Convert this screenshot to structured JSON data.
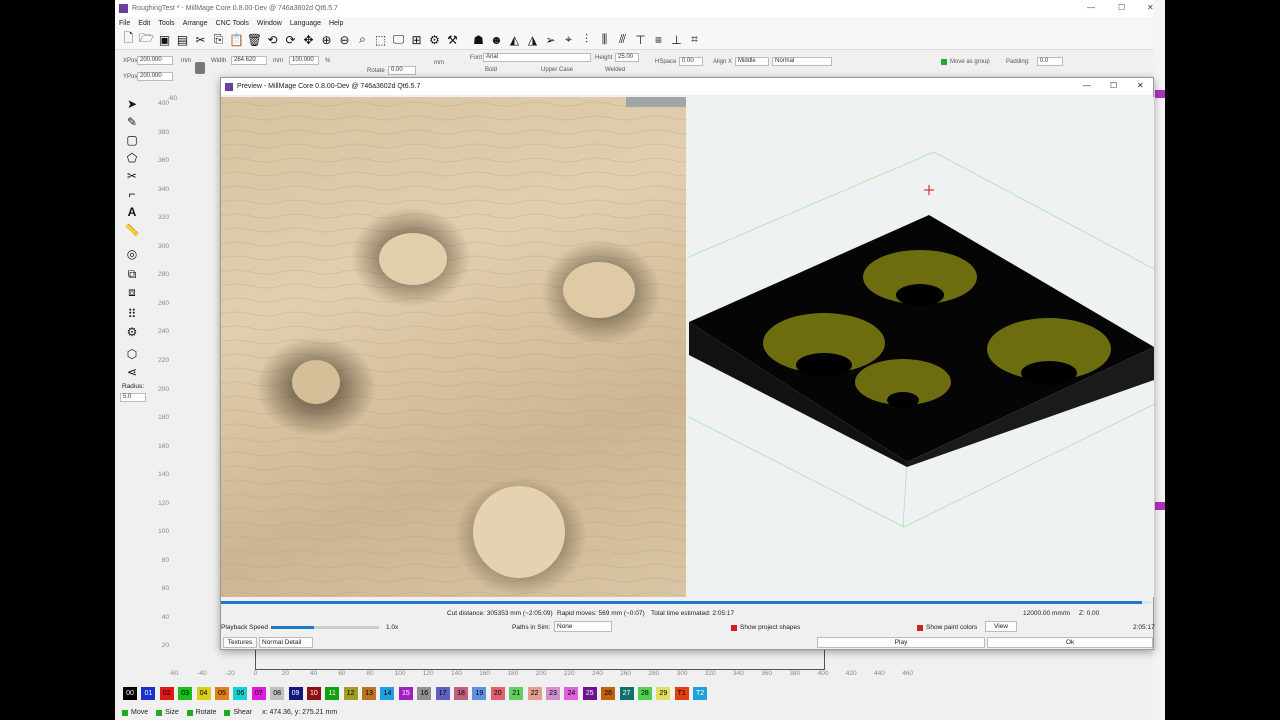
{
  "app": {
    "title": "RoughingTest * - MillMage Core 0.8.00-Dev @ 746a3602d Qt6.5.7",
    "menu": [
      "File",
      "Edit",
      "Tools",
      "Arrange",
      "CNC Tools",
      "Window",
      "Language",
      "Help"
    ]
  },
  "properties": {
    "xpos_label": "XPos",
    "xpos": "200.000",
    "ypos_label": "YPos",
    "ypos": "200.000",
    "width_label": "Width",
    "width": "264.620",
    "unit_mm": "mm",
    "width_pct": "100.000",
    "pct": "%",
    "rotate_label": "Rotate",
    "rotate": "0.00",
    "unit_option": "mm",
    "font_label": "Font",
    "font": "Arial",
    "height_label": "Height",
    "height": "25.00",
    "hspace_label": "HSpace",
    "hspace": "0.00",
    "align_x_label": "Align X",
    "align_x": "Middle",
    "normal": "Normal",
    "bold": "Bold",
    "upper_case": "Upper Case",
    "welded": "Welded",
    "move_as_group": "Move as group",
    "padding_label": "Padding:",
    "padding": "0.0"
  },
  "left_tools": {
    "radius_label": "Radius:",
    "radius": "5.0"
  },
  "ruler_v": [
    "-60",
    "400",
    "380",
    "360",
    "340",
    "320",
    "300",
    "280",
    "260",
    "240",
    "220",
    "200",
    "180",
    "160",
    "140",
    "120",
    "100",
    "80",
    "60",
    "40",
    "20"
  ],
  "ruler_h": [
    "-60",
    "-40",
    "-20",
    "0",
    "20",
    "40",
    "60",
    "80",
    "100",
    "120",
    "140",
    "160",
    "180",
    "200",
    "220",
    "240",
    "260",
    "280",
    "300",
    "320",
    "340",
    "360",
    "380",
    "400",
    "420",
    "440",
    "460"
  ],
  "palette": [
    {
      "label": "00",
      "color": "#000000",
      "text": "#ffffff"
    },
    {
      "label": "01",
      "color": "#1a2fd0",
      "text": "#ffffff"
    },
    {
      "label": "02",
      "color": "#e01818",
      "text": "#000000"
    },
    {
      "label": "03",
      "color": "#18c018",
      "text": "#000000"
    },
    {
      "label": "04",
      "color": "#d8d018",
      "text": "#000000"
    },
    {
      "label": "05",
      "color": "#e08018",
      "text": "#000000"
    },
    {
      "label": "06",
      "color": "#18d0d0",
      "text": "#000000"
    },
    {
      "label": "07",
      "color": "#e018e0",
      "text": "#000000"
    },
    {
      "label": "08",
      "color": "#c0c0c0",
      "text": "#000000"
    },
    {
      "label": "09",
      "color": "#101880",
      "text": "#ffffff"
    },
    {
      "label": "10",
      "color": "#901010",
      "text": "#ffffff"
    },
    {
      "label": "11",
      "color": "#10a010",
      "text": "#ffffff"
    },
    {
      "label": "12",
      "color": "#a0a020",
      "text": "#000000"
    },
    {
      "label": "13",
      "color": "#c07020",
      "text": "#000000"
    },
    {
      "label": "14",
      "color": "#20a0e0",
      "text": "#000000"
    },
    {
      "label": "15",
      "color": "#a020c0",
      "text": "#ffffff"
    },
    {
      "label": "16",
      "color": "#909090",
      "text": "#000000"
    },
    {
      "label": "17",
      "color": "#6060c0",
      "text": "#000000"
    },
    {
      "label": "18",
      "color": "#c06080",
      "text": "#000000"
    },
    {
      "label": "19",
      "color": "#6090e0",
      "text": "#000000"
    },
    {
      "label": "20",
      "color": "#e06070",
      "text": "#000000"
    },
    {
      "label": "21",
      "color": "#60d060",
      "text": "#000000"
    },
    {
      "label": "22",
      "color": "#e0a090",
      "text": "#000000"
    },
    {
      "label": "23",
      "color": "#d090d0",
      "text": "#000000"
    },
    {
      "label": "24",
      "color": "#e060e0",
      "text": "#000000"
    },
    {
      "label": "25",
      "color": "#701090",
      "text": "#ffffff"
    },
    {
      "label": "26",
      "color": "#c06010",
      "text": "#000000"
    },
    {
      "label": "27",
      "color": "#107070",
      "text": "#ffffff"
    },
    {
      "label": "28",
      "color": "#50d050",
      "text": "#000000"
    },
    {
      "label": "29",
      "color": "#e0e060",
      "text": "#000000"
    },
    {
      "label": "T1",
      "color": "#e04010",
      "text": "#000000"
    },
    {
      "label": "T2",
      "color": "#20a0e0",
      "text": "#ffffff"
    }
  ],
  "status": {
    "move": "Move",
    "size": "Size",
    "rotate": "Rotate",
    "shear": "Shear",
    "coords": "x: 474.36, y: 275.21 mm"
  },
  "preview": {
    "title": "Preview - MillMage Core 0.8.00-Dev @ 746a3602d Qt6.5.7",
    "cut_distance": "Cut distance: 305353 mm (~2:05:09)",
    "rapid_moves": "Rapid moves: 569 mm (~0:07)",
    "total_time": "Total time estimated: 2:05:17",
    "feed": "12000.00 mm/m",
    "z": "Z: 0.00",
    "elapsed": "2:05:17",
    "playback_label": "Playback Speed",
    "playback_value": "1.0x",
    "playback_fraction": 0.4,
    "progress_fraction": 0.99,
    "paths_label": "Paths in Sim:",
    "paths_value": "None",
    "show_project_shapes": "Show project shapes",
    "show_paint_colors": "Show paint colors",
    "view_button": "View",
    "textures_button": "Textures",
    "detail_value": "Normal Detail",
    "play_button": "Play",
    "ok_button": "Ok"
  }
}
